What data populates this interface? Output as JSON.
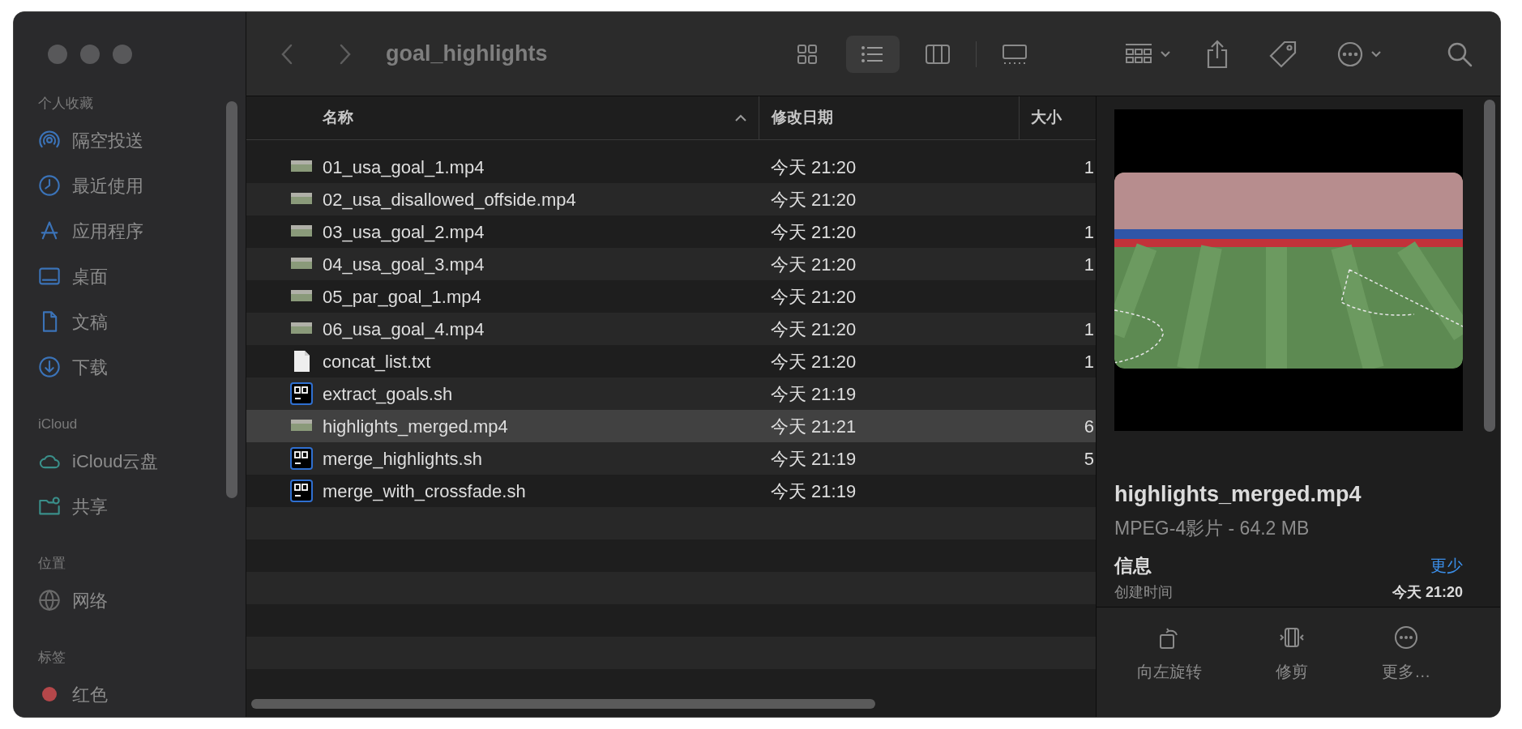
{
  "sidebar": {
    "sections": [
      {
        "heading": "个人收藏",
        "items": [
          {
            "label": "隔空投送",
            "kind": "airdrop"
          },
          {
            "label": "最近使用",
            "kind": "recents"
          },
          {
            "label": "应用程序",
            "kind": "apps"
          },
          {
            "label": "桌面",
            "kind": "desktop"
          },
          {
            "label": "文稿",
            "kind": "documents"
          },
          {
            "label": "下载",
            "kind": "downloads"
          }
        ]
      },
      {
        "heading": "iCloud",
        "items": [
          {
            "label": "iCloud云盘",
            "kind": "icloud"
          },
          {
            "label": "共享",
            "kind": "shared"
          }
        ]
      },
      {
        "heading": "位置",
        "items": [
          {
            "label": "网络",
            "kind": "network"
          }
        ]
      },
      {
        "heading": "标签",
        "items": [
          {
            "label": "红色",
            "kind": "tag",
            "color": "#b5474a"
          }
        ]
      }
    ]
  },
  "toolbar": {
    "title": "goal_highlights",
    "view_modes": [
      {
        "kind": "icons",
        "selected": false
      },
      {
        "kind": "list",
        "selected": true
      },
      {
        "kind": "columns",
        "selected": false
      },
      {
        "kind": "gallery",
        "selected": false
      }
    ]
  },
  "table": {
    "columns": [
      {
        "label": "名称",
        "sorted": true
      },
      {
        "label": "修改日期",
        "sorted": false
      },
      {
        "label": "大小",
        "sorted": false
      }
    ],
    "rows": [
      {
        "name": "01_usa_goal_1.mp4",
        "date": "今天 21:20",
        "size": "1",
        "kind": "video",
        "selected": false
      },
      {
        "name": "02_usa_disallowed_offside.mp4",
        "date": "今天 21:20",
        "kind": "video",
        "selected": false
      },
      {
        "name": "03_usa_goal_2.mp4",
        "date": "今天 21:20",
        "size": "1",
        "kind": "video",
        "selected": false
      },
      {
        "name": "04_usa_goal_3.mp4",
        "date": "今天 21:20",
        "size": "1",
        "kind": "video",
        "selected": false
      },
      {
        "name": "05_par_goal_1.mp4",
        "date": "今天 21:20",
        "kind": "video",
        "selected": false
      },
      {
        "name": "06_usa_goal_4.mp4",
        "date": "今天 21:20",
        "size": "1",
        "kind": "video",
        "selected": false
      },
      {
        "name": "concat_list.txt",
        "date": "今天 21:20",
        "size": "1",
        "kind": "text",
        "selected": false
      },
      {
        "name": "extract_goals.sh",
        "date": "今天 21:19",
        "kind": "script",
        "selected": false
      },
      {
        "name": "highlights_merged.mp4",
        "date": "今天 21:21",
        "size": "6",
        "kind": "video",
        "selected": true
      },
      {
        "name": "merge_highlights.sh",
        "date": "今天 21:19",
        "size": "5",
        "kind": "script",
        "selected": false
      },
      {
        "name": "merge_with_crossfade.sh",
        "date": "今天 21:19",
        "kind": "script",
        "selected": false
      }
    ]
  },
  "preview": {
    "filename": "highlights_merged.mp4",
    "subtitle": "MPEG-4影片 - 64.2 MB",
    "section": "信息",
    "toggle": "更少",
    "info_rows": [
      {
        "label": "创建时间",
        "value": "今天 21:20"
      }
    ],
    "actions": [
      {
        "label": "向左旋转",
        "kind": "rotate"
      },
      {
        "label": "修剪",
        "kind": "trim"
      },
      {
        "label": "更多…",
        "kind": "more"
      }
    ]
  }
}
